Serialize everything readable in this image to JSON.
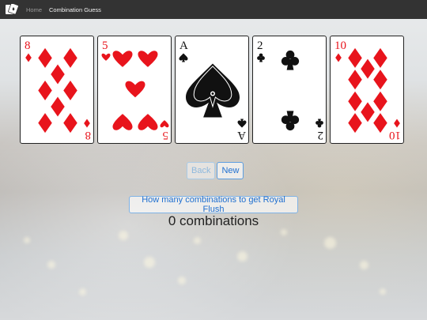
{
  "navbar": {
    "logo_icon": "card-logo-icon",
    "links": [
      {
        "label": "Home",
        "active": false
      },
      {
        "label": "Combination Guess",
        "active": true
      }
    ]
  },
  "cards": [
    {
      "rank": "8",
      "suit": "diamonds",
      "color": "#e8141c"
    },
    {
      "rank": "5",
      "suit": "hearts",
      "color": "#e8141c"
    },
    {
      "rank": "A",
      "suit": "spades",
      "color": "#111111"
    },
    {
      "rank": "2",
      "suit": "clubs",
      "color": "#111111"
    },
    {
      "rank": "10",
      "suit": "diamonds",
      "color": "#e8141c"
    }
  ],
  "buttons": {
    "back_label": "Back",
    "new_label": "New",
    "combos_label": "How many combinations to get Royal Flush"
  },
  "result": {
    "text": "0 combinations"
  }
}
